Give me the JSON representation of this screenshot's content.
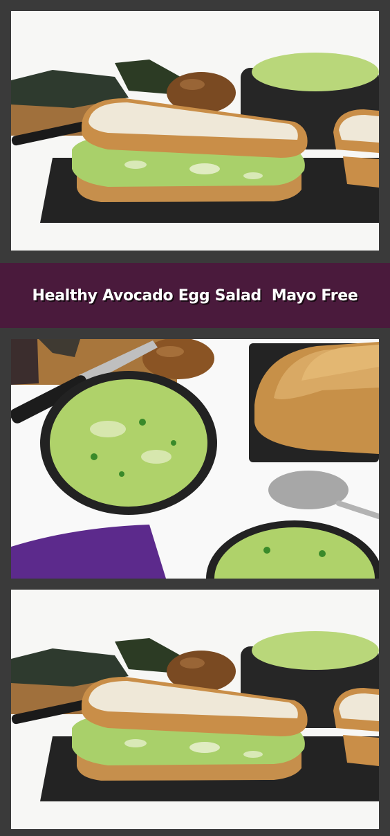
{
  "banner": {
    "title": "Healthy Avocado Egg Salad  Mayo Free",
    "background_color": "#4a1a3c",
    "text_color": "#ffffff"
  },
  "photos": [
    {
      "subject": "avocado egg salad sandwich on slate board"
    },
    {
      "subject": "bowls of avocado egg salad with bread slices, knife and spoon"
    },
    {
      "subject": "avocado egg salad sandwich on slate board"
    }
  ]
}
